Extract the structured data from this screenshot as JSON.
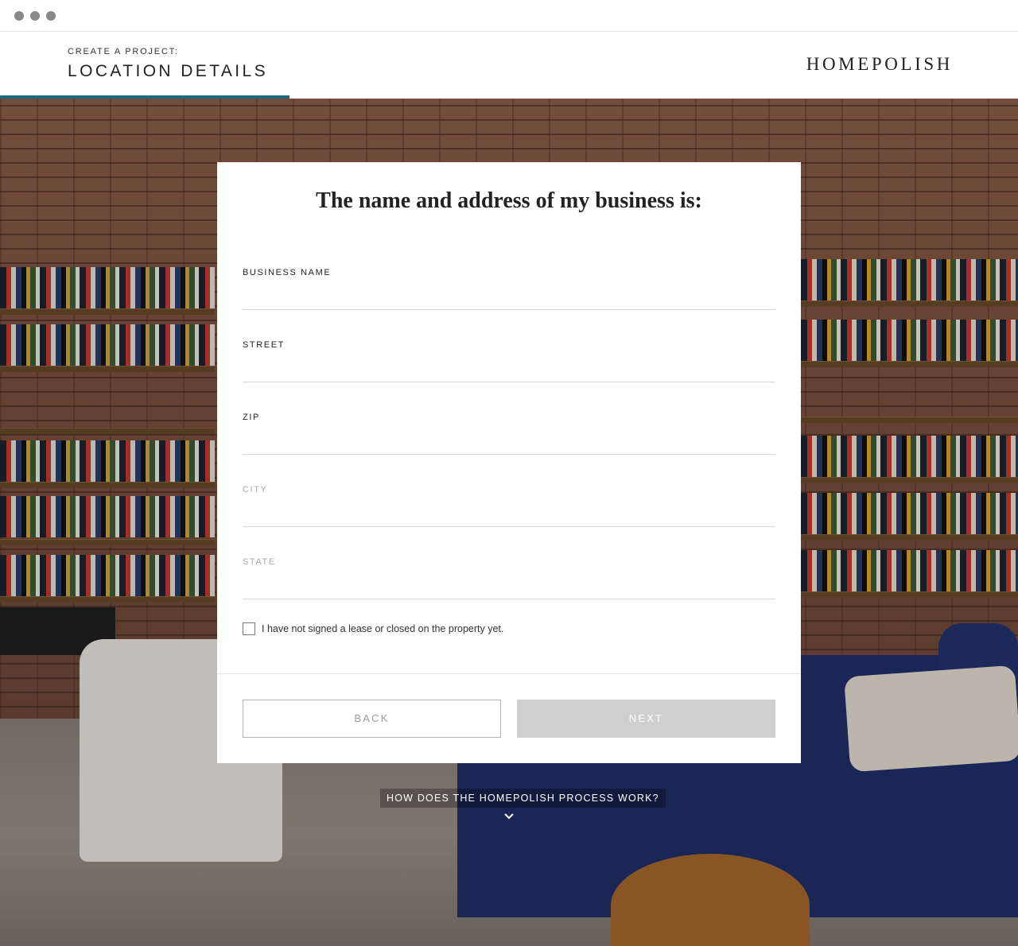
{
  "header": {
    "eyebrow": "CREATE A PROJECT:",
    "step_title": "LOCATION DETAILS",
    "logo": "HOMEPOLISH",
    "progress_fraction": 0.284,
    "accent_color": "#1a6b79"
  },
  "form": {
    "title": "The name and address of my business is:",
    "fields": [
      {
        "label": "BUSINESS NAME",
        "value": "",
        "enabled": true
      },
      {
        "label": "STREET",
        "value": "",
        "enabled": true
      },
      {
        "label": "ZIP",
        "value": "",
        "enabled": true
      },
      {
        "label": "CITY",
        "value": "",
        "enabled": false
      },
      {
        "label": "STATE",
        "value": "",
        "enabled": false
      }
    ],
    "checkbox_label": "I have not signed a lease or closed on the property yet.",
    "checkbox_checked": false,
    "back_label": "BACK",
    "next_label": "NEXT"
  },
  "help": {
    "link_text": "HOW DOES THE HOMEPOLISH PROCESS WORK?",
    "icon": "chevron-down-icon"
  }
}
